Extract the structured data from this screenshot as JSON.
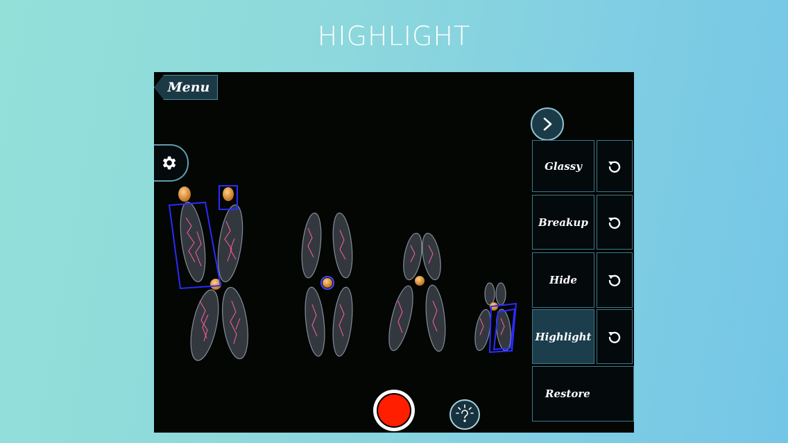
{
  "headline": "HIGHLIGHT",
  "menu": {
    "label": "Menu"
  },
  "panel": {
    "actions": [
      {
        "label": "Glassy",
        "active": false
      },
      {
        "label": "Breakup",
        "active": false
      },
      {
        "label": "Hide",
        "active": false
      },
      {
        "label": "Highlight",
        "active": true
      }
    ],
    "restore_label": "Restore"
  },
  "icons": {
    "settings": "gear-icon",
    "next": "chevron-right-icon",
    "reset": "rotate-ccw-icon",
    "record": "record-icon",
    "help": "lightbulb-question-icon"
  },
  "colors": {
    "background_start": "#93e0d9",
    "background_end": "#74c6e6",
    "screen": "#030603",
    "button": "#1b3a46",
    "button_border": "#3d7a8c",
    "highlight_box": "#2b2bff",
    "record": "#ff1e00",
    "centromere": "#e8a042"
  }
}
